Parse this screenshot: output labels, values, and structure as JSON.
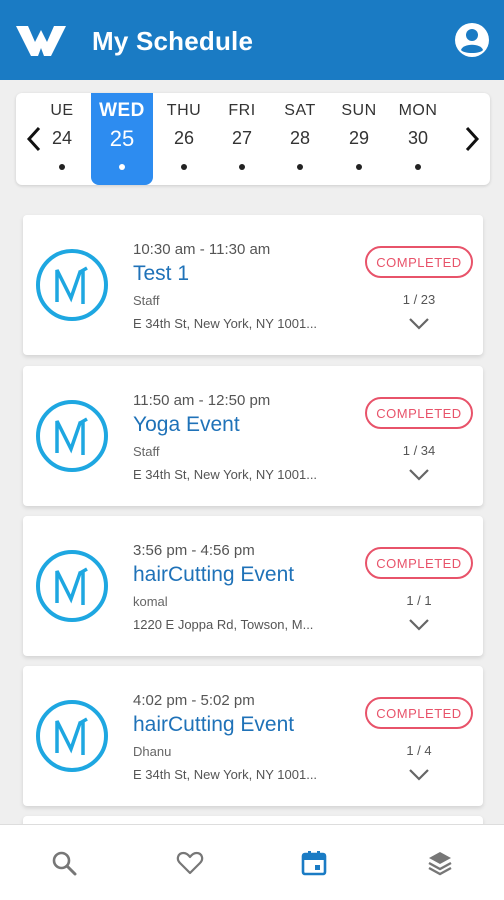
{
  "header": {
    "title": "My Schedule"
  },
  "days": [
    {
      "name": "UE",
      "num": "24"
    },
    {
      "name": "WED",
      "num": "25",
      "selected": true
    },
    {
      "name": "THU",
      "num": "26"
    },
    {
      "name": "FRI",
      "num": "27"
    },
    {
      "name": "SAT",
      "num": "28"
    },
    {
      "name": "SUN",
      "num": "29"
    },
    {
      "name": "MON",
      "num": "30"
    }
  ],
  "events": [
    {
      "time": "10:30 am - 11:30 am",
      "name": "Test 1",
      "role": "Staff",
      "address": "E 34th St, New York, NY 1001...",
      "status": "COMPLETED",
      "count": "1 / 23"
    },
    {
      "time": "11:50 am - 12:50 pm",
      "name": "Yoga Event",
      "role": "Staff",
      "address": "E 34th St, New York, NY 1001...",
      "status": "COMPLETED",
      "count": "1 / 34"
    },
    {
      "time": "3:56 pm - 4:56 pm",
      "name": "hairCutting Event",
      "role": "komal",
      "address": "1220 E Joppa Rd, Towson, M...",
      "status": "COMPLETED",
      "count": "1 / 1"
    },
    {
      "time": "4:02 pm - 5:02 pm",
      "name": "hairCutting Event",
      "role": "Dhanu",
      "address": "E 34th St, New York, NY 1001...",
      "status": "COMPLETED",
      "count": "1 / 4"
    }
  ],
  "icons": {
    "logo": "w-logo-icon",
    "profile": "account-circle-icon",
    "prev": "chevron-left-icon",
    "next": "chevron-right-icon",
    "avatar": "event-logo-icon",
    "expand": "chevron-down-icon",
    "nav": [
      "search-icon",
      "heart-icon",
      "calendar-icon",
      "layers-icon"
    ]
  },
  "colors": {
    "primary": "#1a7bc4",
    "selected_day": "#2d8cf0",
    "status": "#e8536a",
    "event_title": "#1f72b8",
    "nav_active": "#1a7bc4",
    "nav_inactive": "#777777"
  }
}
